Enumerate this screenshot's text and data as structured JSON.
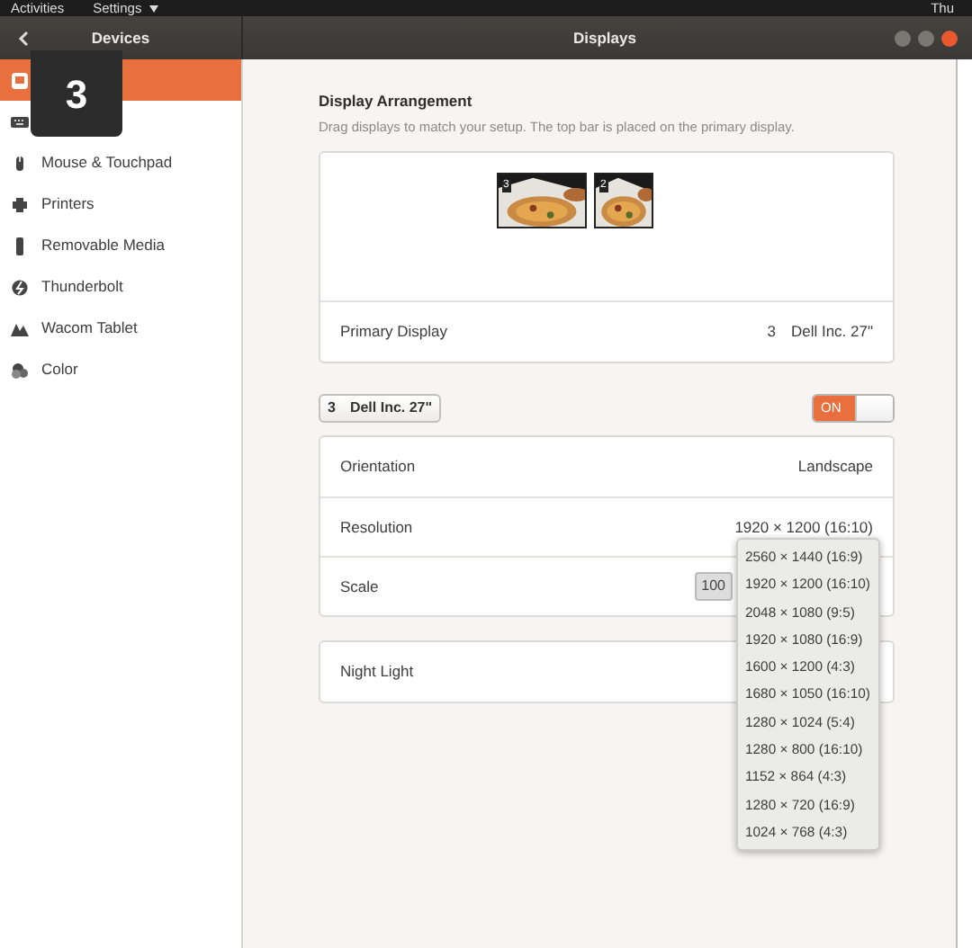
{
  "top_bar": {
    "activities": "Activities",
    "app_menu": "Settings",
    "clock": "Thu"
  },
  "header": {
    "section": "Devices",
    "title": "Displays"
  },
  "sidebar": {
    "items": [
      {
        "selected": true
      },
      {
        "selected": false
      },
      {
        "label": "Mouse & Touchpad",
        "selected": false
      },
      {
        "label": "Printers",
        "selected": false
      },
      {
        "label": "Removable Media",
        "selected": false
      },
      {
        "label": "Thunderbolt",
        "selected": false
      },
      {
        "label": "Wacom Tablet",
        "selected": false
      },
      {
        "label": "Color",
        "selected": false
      }
    ]
  },
  "identify_overlay": {
    "number": "3"
  },
  "arrangement": {
    "title": "Display Arrangement",
    "subtitle": "Drag displays to match your setup. The top bar is placed on the primary display.",
    "monitors": [
      {
        "number": "3",
        "kind": "wide"
      },
      {
        "number": "2",
        "kind": "narrow"
      }
    ],
    "primary_display": {
      "label": "Primary Display",
      "number": "3",
      "name": "Dell Inc. 27\""
    }
  },
  "display": {
    "button": {
      "number": "3",
      "name": "Dell Inc. 27\""
    },
    "power": {
      "label": "ON",
      "on": true
    },
    "rows": [
      {
        "kind": "value",
        "label": "Orientation",
        "value": "Landscape"
      },
      {
        "kind": "value",
        "label": "Resolution",
        "value": "1920 × 1200 (16:10)"
      },
      {
        "kind": "button",
        "label": "Scale",
        "value": "100"
      }
    ],
    "night_light": {
      "label": "Night Light"
    }
  },
  "resolution_menu": {
    "options": [
      "2560 × 1440 (16:9)",
      "1920 × 1200 (16:10)",
      "2048 × 1080 (9:5)",
      "1920 × 1080 (16:9)",
      "1600 × 1200 (4:3)",
      "1680 × 1050 (16:10)",
      "1280 × 1024 (5:4)",
      "1280 × 800 (16:10)",
      "1152 × 864 (4:3)",
      "1280 × 720 (16:9)",
      "1024 × 768 (4:3)"
    ]
  }
}
